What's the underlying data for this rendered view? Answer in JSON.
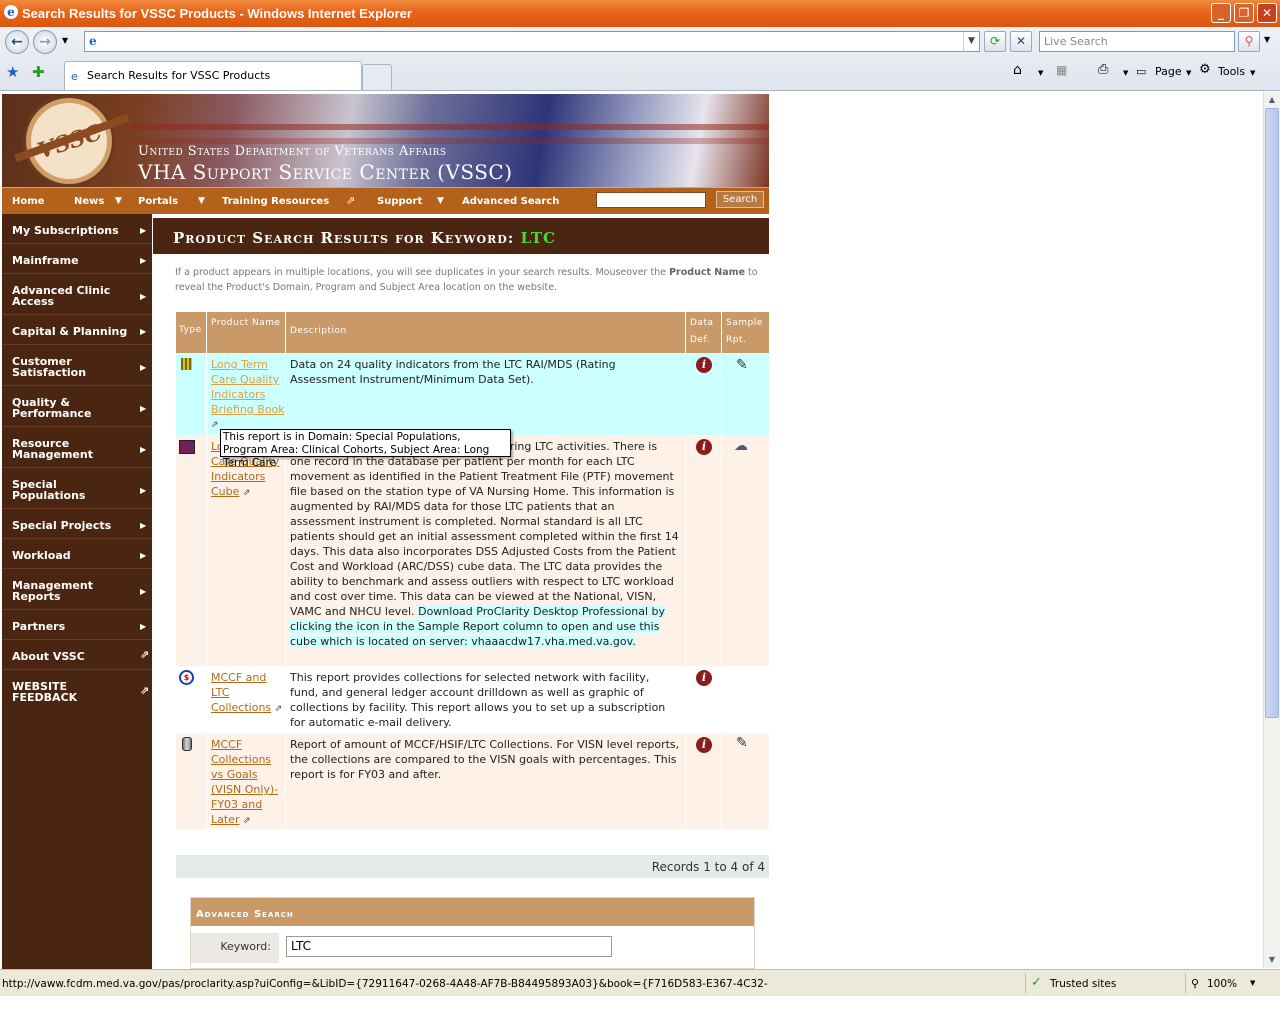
{
  "window": {
    "title": "Search Results for VSSC Products - Windows Internet Explorer",
    "minimize": "_",
    "restore": "❐",
    "close": "✕"
  },
  "browser": {
    "address": "",
    "live_search_placeholder": "Live Search",
    "tab_title": "Search Results for VSSC Products",
    "commands": {
      "page": "Page",
      "tools": "Tools"
    }
  },
  "banner": {
    "seal": "VSSC",
    "line1": "United States Department of Veterans Affairs",
    "line2": "VHA Support Service Center (VSSC)"
  },
  "topnav": {
    "items": [
      "Home",
      "News",
      "Portals",
      "Training Resources",
      "Support",
      "Advanced Search"
    ],
    "search_button": "Search"
  },
  "leftnav": {
    "items": [
      "My Subscriptions",
      "Mainframe",
      "Advanced Clinic Access",
      "Capital & Planning",
      "Customer Satisfaction",
      "Quality & Performance",
      "Resource Management",
      "Special Populations",
      "Special Projects",
      "Workload",
      "Management Reports",
      "Partners",
      "About VSSC",
      "WEBSITE FEEDBACK"
    ]
  },
  "main": {
    "heading_prefix": "Product Search Results for Keyword:",
    "keyword": "LTC",
    "intro_a": "If a product appears in multiple locations, you will see duplicates in your search results. Mouseover the ",
    "intro_b": "Product Name",
    "intro_c": " to reveal the Product's Domain, Program and Subject Area location on the website.",
    "columns": {
      "type": "Type",
      "product": "Product Name",
      "description": "Description",
      "data_def": "Data Def.",
      "sample": "Sample Rpt."
    },
    "rows": [
      {
        "name": "Long Term Care Quality Indicators Briefing Book",
        "description": "Data on 24 quality indicators from the LTC RAI/MDS (Rating Assessment Instrument/Minimum Data Set)."
      },
      {
        "name": "Long Term Care Quality Indicators Cube",
        "description": "...ed to be used in reporting and monitoring LTC activities. There is one record in the database per patient per month for each LTC movement as identified in the Patient Treatment File (PTF) movement file based on the station type of VA Nursing Home. This information is augmented by RAI/MDS data for those LTC patients that an assessment instrument is completed. Normal standard is all LTC patients should get an initial assessment completed within the first 14 days. This data also incorporates DSS Adjusted Costs from the Patient Cost and Workload (ARC/DSS) cube data. The LTC data provides the ability to benchmark and assess outliers with respect to LTC workload and cost over time. This data can be viewed at the National, VISN, VAMC and NHCU level. ",
        "highlight": "Download ProClarity Desktop Professional by clicking the icon in the Sample Report column to open and use this cube which is located on server: vhaaacdw17.vha.med.va.gov."
      },
      {
        "name": "MCCF and LTC Collections",
        "description": "This report provides collections for selected network with facility, fund, and general ledger account drilldown as well as graphic of collections by facility. This report allows you to set up a subscription for automatic e-mail delivery."
      },
      {
        "name": "MCCF Collections vs Goals (VISN Only)-FY03 and Later",
        "description": "Report of amount of MCCF/HSIF/LTC Collections. For VISN level reports, the collections are compared to the VISN goals with percentages. This report is for FY03 and after."
      }
    ],
    "tooltip": "This report is in Domain: Special Populations, Program Area: Clinical Cohorts, Subject Area: Long Term Care",
    "records": "Records 1 to 4 of 4",
    "advanced": {
      "title": "Advanced Search",
      "keyword_label": "Keyword:",
      "keyword_value": "LTC"
    }
  },
  "status": {
    "url": "http://vaww.fcdm.med.va.gov/pas/proclarity.asp?uiConfig=&LibID={72911647-0268-4A48-AF7B-B84495893A03}&book={F716D583-E367-4C32-",
    "zone": "Trusted sites",
    "zoom": "100%"
  }
}
